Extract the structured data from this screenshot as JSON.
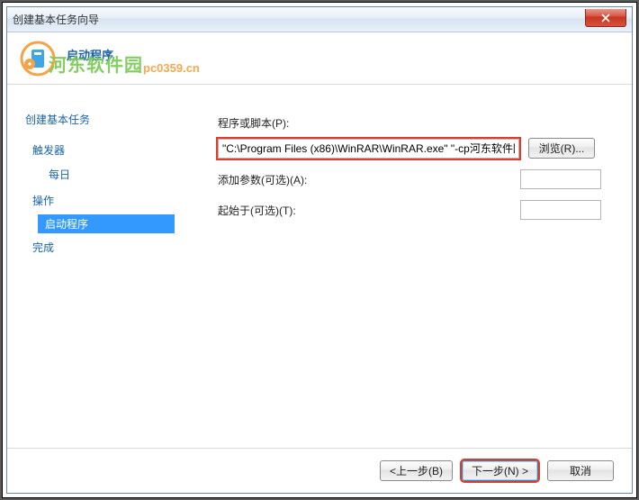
{
  "window": {
    "title": "创建基本任务向导"
  },
  "header": {
    "heading": "启动程序"
  },
  "watermark": {
    "text": "河东软件园",
    "url": "pc0359.cn"
  },
  "sidebar": {
    "section1": "创建基本任务",
    "trigger": "触发器",
    "trigger_sub": "每日",
    "action": "操作",
    "action_sub": "启动程序",
    "finish": "完成"
  },
  "form": {
    "script_label": "程序或脚本(P):",
    "script_value": "\"C:\\Program Files (x86)\\WinRAR\\WinRAR.exe\" \"-cp河东软件园测",
    "browse": "浏览(R)...",
    "args_label": "添加参数(可选)(A):",
    "args_value": "",
    "startin_label": "起始于(可选)(T):",
    "startin_value": ""
  },
  "footer": {
    "back": "<上一步(B)",
    "next": "下一步(N) >",
    "cancel": "取消"
  }
}
